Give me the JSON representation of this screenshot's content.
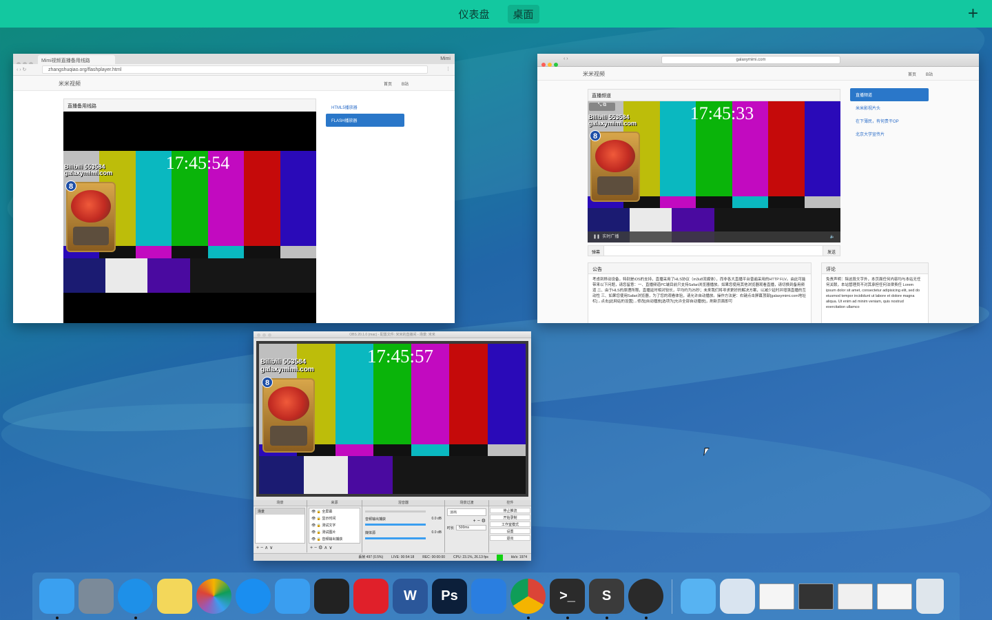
{
  "topbar": {
    "spaces": [
      "仪表盘",
      "桌面"
    ],
    "active_index": 1,
    "add_label": "+"
  },
  "chrome_window": {
    "tab_title": "Mimi视频直播备用线路",
    "profile": "Mimi",
    "url": "zhangshuqiao.org/flashplayer.html",
    "site_name": "米米视频",
    "nav": [
      "首页",
      "B站"
    ],
    "panel_title": "直播备用线路",
    "clock": "17:45:54",
    "watermark_line1": "Bilibili 553584",
    "watermark_line2": "galaxymimi.com",
    "badge": "8",
    "side_links": [
      "HTML5播放器",
      "FLASH播放器"
    ]
  },
  "safari_window": {
    "url": "galaxymimi.com",
    "site_name": "米米视频",
    "nav": [
      "首页",
      "B站"
    ],
    "panel_title": "直播频道",
    "clock": "17:45:33",
    "watermark_line1": "Bilibili 553584",
    "watermark_line2": "galaxymimi.com",
    "badge": "8",
    "live_label": "实时广播",
    "danmaku_label": "弹幕",
    "send_label": "发送",
    "side_links": [
      "直播频道",
      "米米影视片头",
      "在下薄民，有何贵干OP",
      "北京大学宣传片"
    ],
    "notice_title": "公告",
    "notice_text": "考虑到移动设备，特别是iOS的支持，直播采用了HLS协议（m3u8流媒体），而非各大直播平台普遍采用的HTTP FLV。由此可能带来以下问题，请您留意：一、直播频道PC端目前只支持Safari浏览器播放。如果您使用其他浏览器观看直播，请切换到备用频道 二、由于HLS的原理所限，直播延时相对较长，平均约为25秒；未来我们将寻求更好的解决方案，以减少延时并增强直播的互动性 三、如果您使用Safari浏览器，为了您的观看体验，请允许自动播放。操作方法是：右键点击屏幕顶部[galaxymimi.com地址栏]→点击[此网站的设置]→修改[自动播放]选项为[允许全部自动播放]，刷新页面即可",
    "comment_title": "评论",
    "comment_text": "免责声明：除这段文字外，本页面任何内容均与本站无任何关联，本站管理员不对其承担任何法律责任 Lorem ipsum dolor sit amet, consectetur adipisicing elit, sed do eiusmod tempor incididunt ut labore et dolore magna aliqua. Ut enim ad minim veniam, quis nostrud exercitation ullamco"
  },
  "obs_window": {
    "title": "OBS 20.1.0 (mac) - 配置文件: 米米的直播间 - 场景: 米米",
    "clock": "17:45:57",
    "watermark_line1": "Bilibili 553584",
    "watermark_line2": "galaxymimi.com",
    "badge": "8",
    "panels": [
      "场景",
      "来源",
      "混音器",
      "场景过渡",
      "控件"
    ],
    "scene": "场景",
    "sources": [
      "全屏幕",
      "显示时间",
      "测试文字",
      "测试图片",
      "音频输出捕获"
    ],
    "mixer": [
      {
        "name": "音频输出捕获",
        "db": "0.0 dB"
      },
      {
        "name": "媒体源",
        "db": "0.0 dB"
      }
    ],
    "transition": "淡出",
    "duration_label": "时长",
    "duration": "500ms",
    "controls": [
      "停止推流",
      "开始录制",
      "工作室模式",
      "设置",
      "退出"
    ],
    "status": {
      "dropped": "丢帧 497 (0.5%)",
      "live": "LIVE: 00:54:18",
      "rec": "REC: 00:00:00",
      "cpu": "CPU: 23.1%, 26.13 fps",
      "kbps": "kb/s: 1974"
    }
  },
  "dock": {
    "apps": [
      {
        "name": "finder-icon",
        "label": "",
        "color": "#3aa0f0",
        "running": true
      },
      {
        "name": "launchpad-icon",
        "label": "",
        "color": "#7b8a99",
        "running": false
      },
      {
        "name": "safari-icon",
        "label": "",
        "color": "#1e90e8",
        "running": true
      },
      {
        "name": "notes-icon",
        "label": "",
        "color": "#f3d75a",
        "running": false
      },
      {
        "name": "photos-icon",
        "label": "",
        "color": "#f2f2f2",
        "running": false
      },
      {
        "name": "app-store-icon",
        "label": "",
        "color": "#1a8ef0",
        "running": false
      },
      {
        "name": "mail-icon",
        "label": "",
        "color": "#3a9ef0",
        "running": false
      },
      {
        "name": "qq-icon",
        "label": "",
        "color": "#222222",
        "running": false
      },
      {
        "name": "netease-music-icon",
        "label": "",
        "color": "#e0202a",
        "running": false
      },
      {
        "name": "word-icon",
        "label": "W",
        "color": "#2b579a",
        "running": false
      },
      {
        "name": "photoshop-icon",
        "label": "Ps",
        "color": "#0c1f3a",
        "running": false
      },
      {
        "name": "xcode-icon",
        "label": "",
        "color": "#2a7ee0",
        "running": false
      },
      {
        "name": "chrome-icon",
        "label": "",
        "color": "#e8e8e8",
        "running": true
      },
      {
        "name": "terminal-icon",
        "label": ">_",
        "color": "#2b2b2b",
        "running": true
      },
      {
        "name": "sublime-icon",
        "label": "S",
        "color": "#3b3b3b",
        "running": true
      },
      {
        "name": "obs-icon",
        "label": "",
        "color": "#2a2a2a",
        "running": true
      }
    ],
    "others": [
      {
        "name": "downloads-folder-icon",
        "color": "#57b3f2"
      },
      {
        "name": "document-stack-icon",
        "color": "#d9e4f0"
      },
      {
        "name": "minimized-window-safari-icon",
        "color": "#f5f5f5"
      },
      {
        "name": "minimized-window-sublime-icon",
        "color": "#333333"
      },
      {
        "name": "minimized-window-safari2-icon",
        "color": "#f0f0f0"
      },
      {
        "name": "minimized-window-chrome-icon",
        "color": "#f5f5f5"
      },
      {
        "name": "trash-icon",
        "color": "#dfe6ec"
      }
    ]
  }
}
